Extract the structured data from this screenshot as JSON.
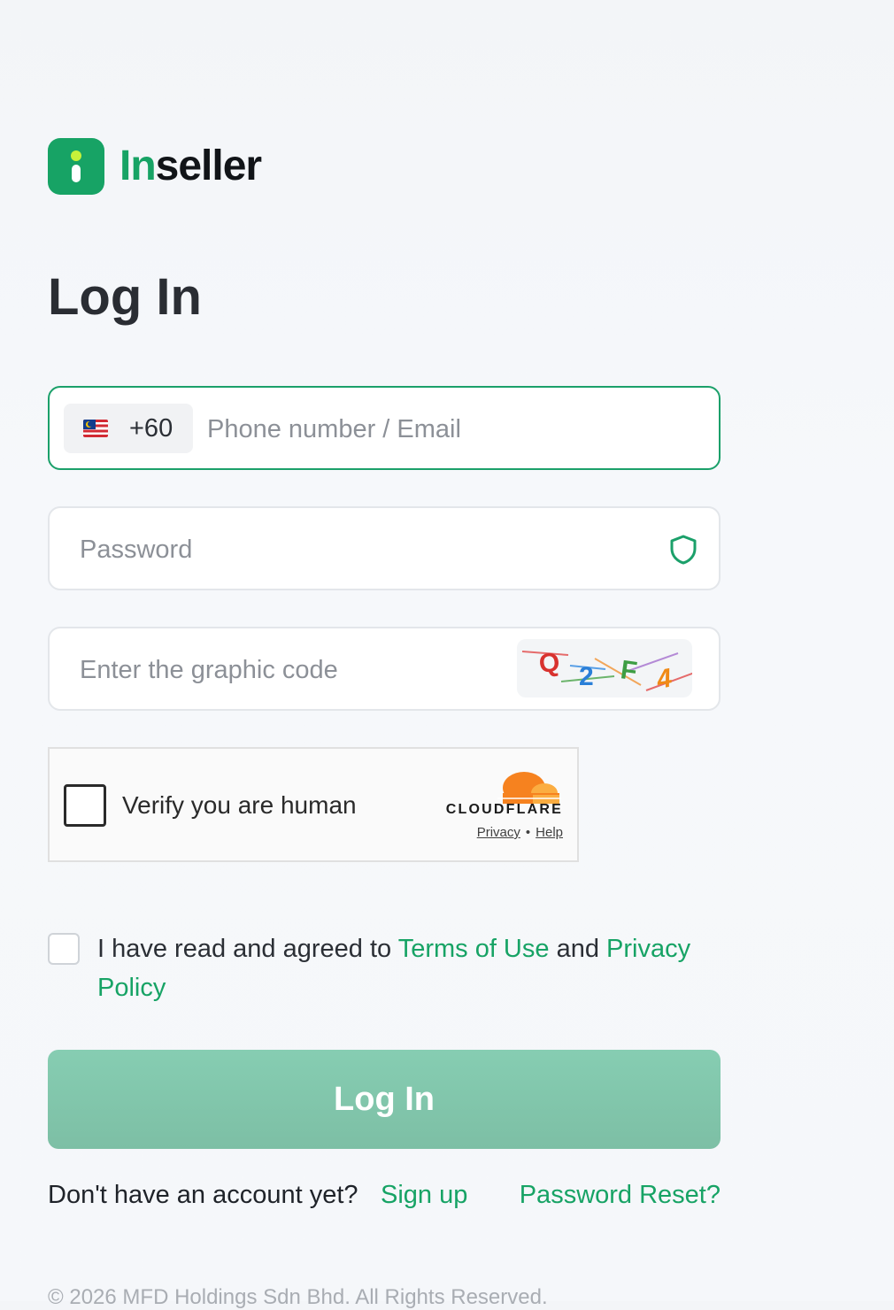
{
  "brand": {
    "name_part1": "In",
    "name_part2": "seller",
    "primary_color": "#17a365",
    "accent_dot_color": "#c6f23a"
  },
  "page": {
    "title": "Log In"
  },
  "phone_field": {
    "country_flag": "malaysia-flag-icon",
    "country_code": "+60",
    "placeholder": "Phone number / Email",
    "value": ""
  },
  "password_field": {
    "placeholder": "Password",
    "value": "",
    "icon": "shield-icon"
  },
  "captcha_field": {
    "placeholder": "Enter the graphic code",
    "value": "",
    "captcha_chars": [
      "Q",
      "2",
      "F",
      "4"
    ]
  },
  "turnstile": {
    "label": "Verify you are human",
    "provider": "CLOUDFLARE",
    "privacy": "Privacy",
    "separator": "•",
    "help": "Help"
  },
  "agreement": {
    "prefix": "I have read and agreed to ",
    "terms": "Terms of Use",
    "conjunction": " and ",
    "privacy": "Privacy Policy",
    "checked": false
  },
  "actions": {
    "login_label": "Log In",
    "no_account_text": "Don't have an account yet?",
    "signup_label": "Sign up",
    "reset_label": "Password Reset?"
  },
  "footer": {
    "copyright": "© 2026 MFD Holdings Sdn Bhd. All Rights Reserved."
  }
}
